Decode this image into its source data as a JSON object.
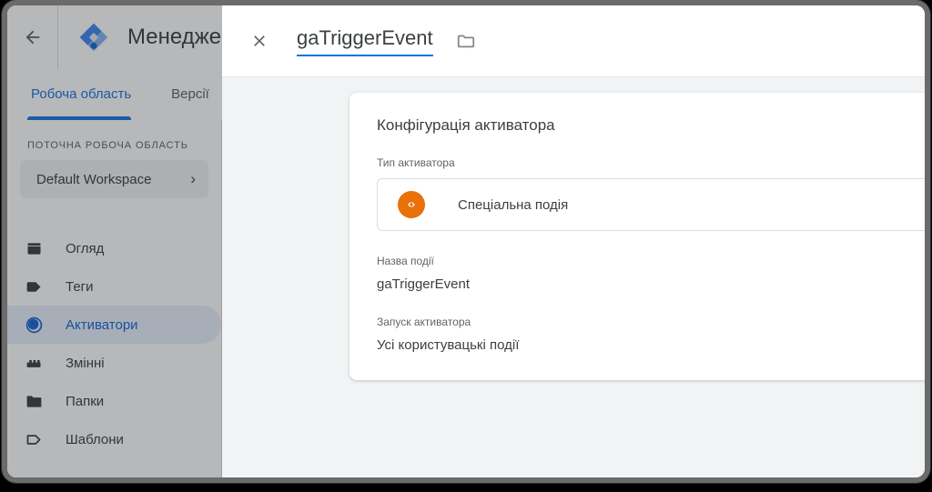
{
  "app": {
    "back_icon": "back-arrow-icon",
    "logo_icon": "google-tag-manager-logo",
    "title": "Менеджер т",
    "tabs": [
      {
        "label": "Робоча область",
        "active": true
      },
      {
        "label": "Версії",
        "active": false
      }
    ],
    "sidebar": {
      "section_label": "ПОТОЧНА РОБОЧА ОБЛАСТЬ",
      "workspace": {
        "name": "Default Workspace",
        "chevron": "›"
      },
      "items": [
        {
          "label": "Огляд",
          "icon": "overview-icon",
          "selected": false
        },
        {
          "label": "Теги",
          "icon": "tag-icon",
          "selected": false
        },
        {
          "label": "Активатори",
          "icon": "trigger-icon",
          "selected": true
        },
        {
          "label": "Змінні",
          "icon": "variables-icon",
          "selected": false
        },
        {
          "label": "Папки",
          "icon": "folder-icon",
          "selected": false
        },
        {
          "label": "Шаблони",
          "icon": "template-icon",
          "selected": false
        }
      ]
    }
  },
  "modal": {
    "close_icon": "close-icon",
    "title": "gaTriggerEvent",
    "folder_icon": "folder-icon",
    "card": {
      "title": "Конфігурація активатора",
      "type_label": "Тип активатора",
      "type_icon": "code-brackets-icon",
      "type_icon_color": "#e8710a",
      "type_value": "Спеціальна подія",
      "event_name_label": "Назва події",
      "event_name_value": "gaTriggerEvent",
      "fire_on_label": "Запуск активатора",
      "fire_on_value": "Усі користувацькі події"
    }
  },
  "colors": {
    "accent": "#1a73e8",
    "selected_nav_bg": "#e8f0fe",
    "selected_nav_fg": "#1967d2",
    "page_bg": "#f1f3f4",
    "orange": "#e8710a"
  }
}
